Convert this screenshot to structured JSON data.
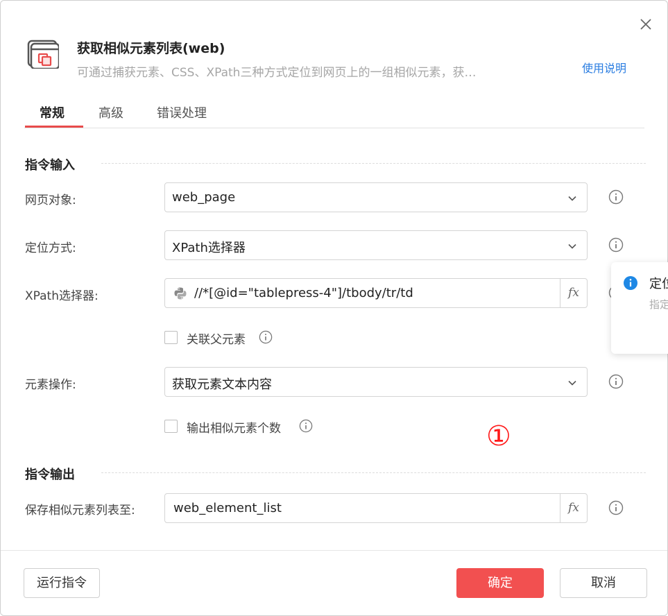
{
  "dialog": {
    "title": "获取相似元素列表(web)",
    "subtitle": "可通过捕获元素、CSS、XPath三种方式定位到网页上的一组相似元素，获…",
    "help_link": "使用说明"
  },
  "tabs": [
    {
      "label": "常规",
      "active": true
    },
    {
      "label": "高级",
      "active": false
    },
    {
      "label": "错误处理",
      "active": false
    }
  ],
  "input_section": {
    "title": "指令输入",
    "web_page": {
      "label": "网页对象:",
      "value": "web_page"
    },
    "locate_method": {
      "label": "定位方式:",
      "value": "XPath选择器"
    },
    "xpath_selector": {
      "label": "XPath选择器:",
      "value": "//*[@id=\"tablepress-4\"]/tbody/tr/td",
      "fx": "fx"
    },
    "related_parent": {
      "label": "关联父元素",
      "checked": false
    },
    "element_operation": {
      "label": "元素操作:",
      "value": "获取元素文本内容"
    },
    "output_count": {
      "label": "输出相似元素个数",
      "checked": false
    }
  },
  "annotation": "①",
  "output_section": {
    "title": "指令输出",
    "save_list": {
      "label": "保存相似元素列表至:",
      "value": "web_element_list",
      "fx": "fx"
    }
  },
  "toast": {
    "title": "定位",
    "desc": "指定"
  },
  "footer": {
    "run_button": "运行指令",
    "confirm_button": "确定",
    "cancel_button": "取消"
  },
  "colors": {
    "accent": "#f25050",
    "link": "#2a7de1",
    "annotation": "#ff1a1a",
    "info": "#1e88e5"
  }
}
